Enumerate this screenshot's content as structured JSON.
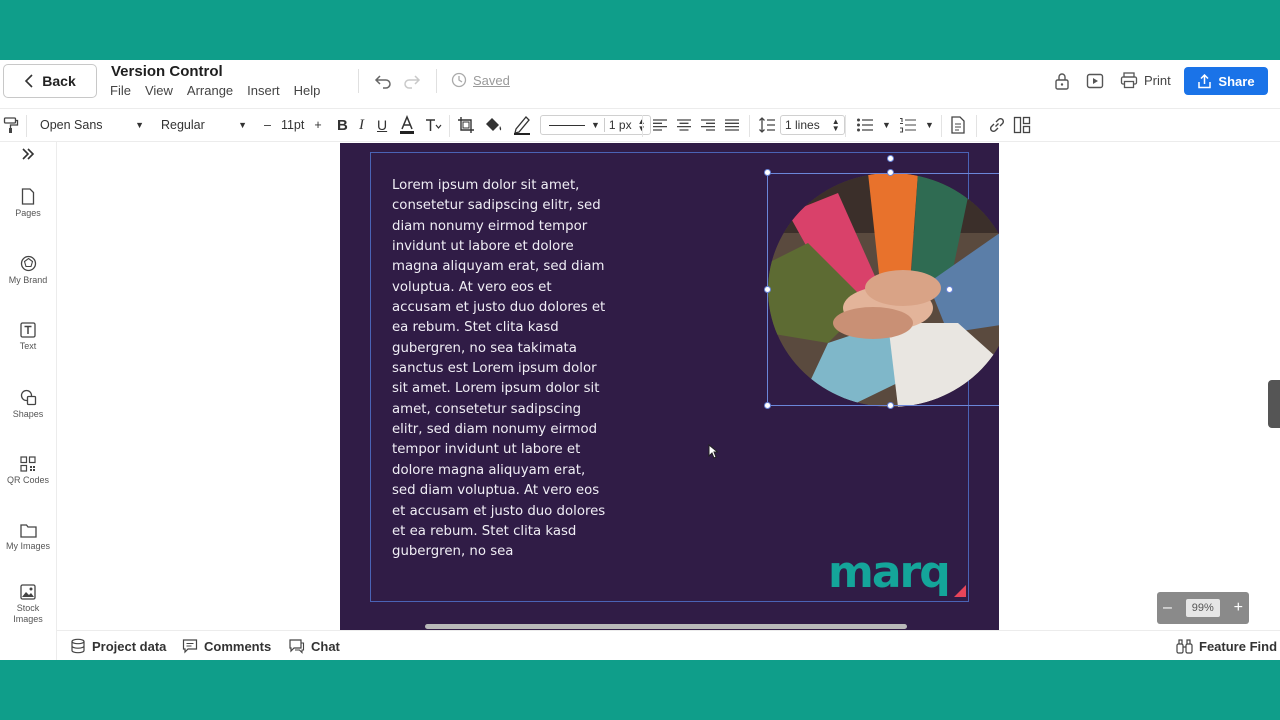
{
  "header": {
    "back_label": "Back",
    "doc_title": "Version Control",
    "menu": [
      "File",
      "View",
      "Arrange",
      "Insert",
      "Help"
    ],
    "saved_label": "Saved",
    "print_label": "Print",
    "share_label": "Share"
  },
  "toolbar": {
    "font_family": "Open Sans",
    "font_weight": "Regular",
    "font_size": "11pt",
    "stroke_width": "1 px",
    "line_spacing": "1 lines"
  },
  "sidebar": {
    "items": [
      {
        "label": "Pages",
        "icon": "page-icon"
      },
      {
        "label": "My Brand",
        "icon": "brand-icon"
      },
      {
        "label": "Text",
        "icon": "text-icon"
      },
      {
        "label": "Shapes",
        "icon": "shapes-icon"
      },
      {
        "label": "QR Codes",
        "icon": "qr-code-icon"
      },
      {
        "label": "My Images",
        "icon": "folder-icon"
      },
      {
        "label": "Stock Images",
        "icon": "image-icon"
      }
    ]
  },
  "canvas": {
    "body_lines": [
      "Lorem ipsum dolor sit amet,",
      "consetetur sadipscing elitr, sed",
      "diam nonumy eirmod tempor",
      "invidunt ut labore et dolore",
      "magna aliquyam erat, sed diam",
      "voluptua. At vero eos et",
      "accusam et justo duo dolores et",
      "ea rebum. Stet clita kasd",
      "gubergren, no sea takimata",
      "sanctus est Lorem ipsum dolor",
      "sit amet. Lorem ipsum dolor sit",
      "amet, consetetur sadipscing",
      "elitr, sed diam nonumy eirmod",
      "tempor invidunt ut labore et",
      "dolore magna aliquyam erat,",
      "sed diam voluptua. At vero eos",
      "et accusam et justo duo dolores",
      "et ea rebum. Stet clita kasd",
      "gubergren, no sea"
    ],
    "logo_text": "marq",
    "zoom": "99%"
  },
  "bottombar": {
    "project_data": "Project data",
    "comments": "Comments",
    "chat": "Chat",
    "feature_find": "Feature Find"
  },
  "colors": {
    "frame_teal": "#0f9e8a",
    "page_bg": "#301c46",
    "share_blue": "#1a73e8",
    "logo_teal": "#14a59a",
    "logo_accent": "#e8455a"
  }
}
